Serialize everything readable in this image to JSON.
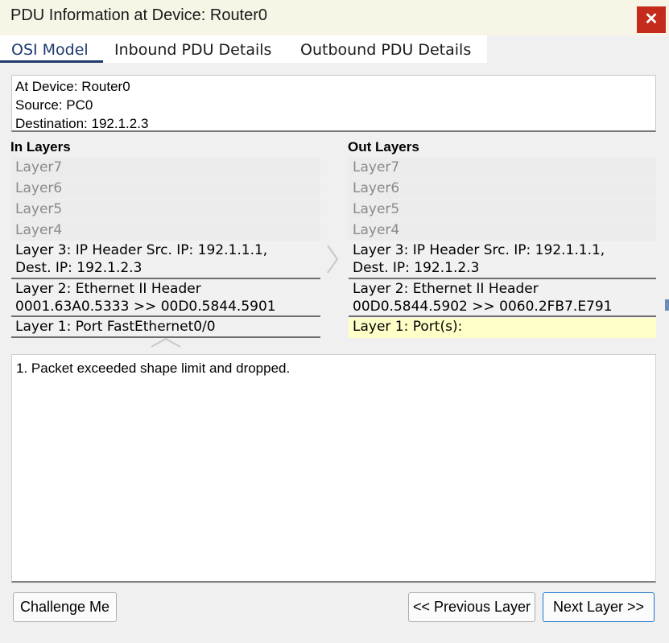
{
  "window": {
    "title": "PDU Information at Device: Router0",
    "close_glyph": "✕"
  },
  "tabs": [
    {
      "label": "OSI Model",
      "active": true
    },
    {
      "label": "Inbound PDU Details",
      "active": false
    },
    {
      "label": "Outbound PDU Details",
      "active": false
    }
  ],
  "info": {
    "device": "At Device: Router0",
    "source": "Source: PC0",
    "destination": "Destination: 192.1.2.3"
  },
  "in_layers": {
    "header": "In Layers",
    "layer7": "Layer7",
    "layer6": "Layer6",
    "layer5": "Layer5",
    "layer4": "Layer4",
    "layer3_line1": "Layer 3: IP Header Src. IP: 192.1.1.1,",
    "layer3_line2": "Dest. IP: 192.1.2.3",
    "layer2_line1": "Layer 2: Ethernet II Header",
    "layer2_line2": "0001.63A0.5333 >> 00D0.5844.5901",
    "layer1": "Layer 1: Port FastEthernet0/0"
  },
  "out_layers": {
    "header": "Out Layers",
    "layer7": "Layer7",
    "layer6": "Layer6",
    "layer5": "Layer5",
    "layer4": "Layer4",
    "layer3_line1": "Layer 3: IP Header Src. IP: 192.1.1.1,",
    "layer3_line2": "Dest. IP: 192.1.2.3",
    "layer2_line1": "Layer 2: Ethernet II Header",
    "layer2_line2": "00D0.5844.5902 >> 0060.2FB7.E791",
    "layer1": "Layer 1: Port(s):"
  },
  "details": {
    "line1": "1. Packet exceeded shape limit and dropped."
  },
  "buttons": {
    "challenge": "Challenge Me",
    "previous": "<< Previous Layer",
    "next": "Next Layer >>"
  },
  "colors": {
    "close_red": "#c42b1c",
    "active_tab": "#1d3b6e",
    "highlight_yellow": "#ffffc8",
    "next_border_blue": "#1a73c8"
  },
  "icons": [
    "close-icon",
    "right-arrow-icon",
    "up-arrow-icon"
  ]
}
